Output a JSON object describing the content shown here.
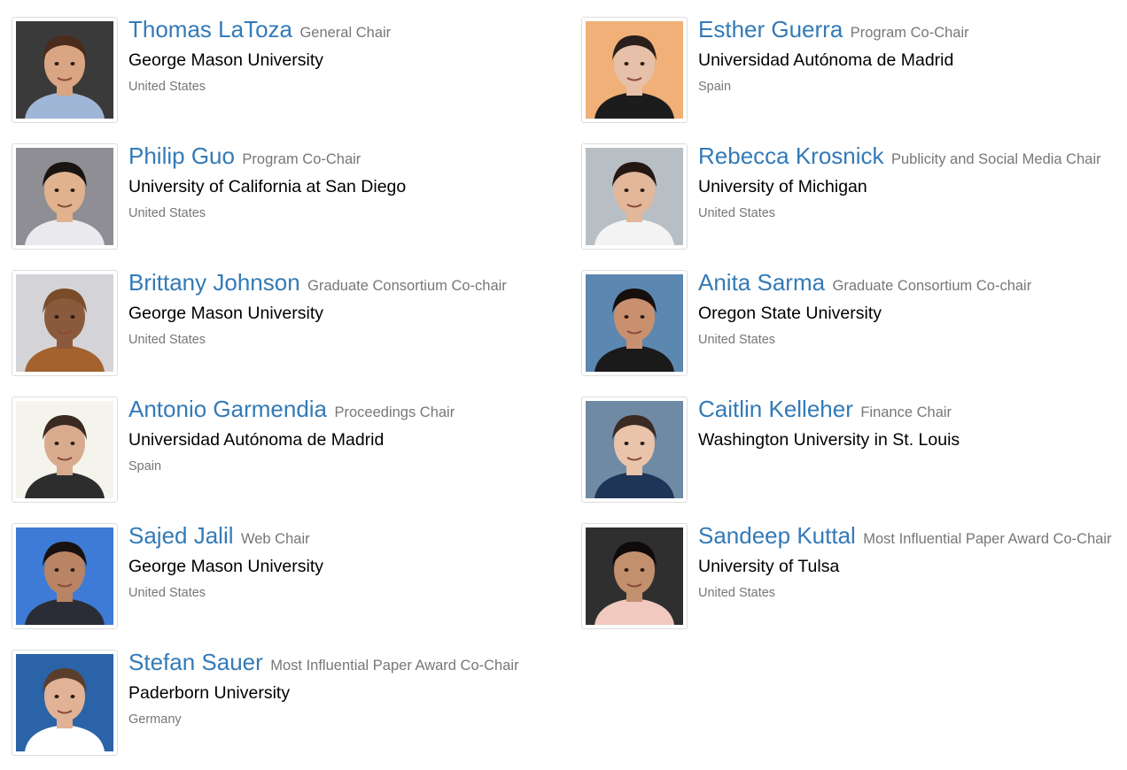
{
  "people": [
    {
      "name": "Thomas LaToza",
      "role": "General Chair",
      "affiliation": "George Mason University",
      "country": "United States",
      "colors": {
        "bg": "#3b3a3a",
        "skin": "#d9a583",
        "hair": "#4a2c1c",
        "shirt": "#9fb6d6"
      }
    },
    {
      "name": "Esther Guerra",
      "role": "Program Co-Chair",
      "affiliation": "Universidad Autónoma de Madrid",
      "country": "Spain",
      "colors": {
        "bg": "#f0b078",
        "skin": "#e6c0a8",
        "hair": "#2b1f1b",
        "shirt": "#1c1c1c"
      }
    },
    {
      "name": "Philip Guo",
      "role": "Program Co-Chair",
      "affiliation": "University of California at San Diego",
      "country": "United States",
      "colors": {
        "bg": "#8f8e95",
        "skin": "#e0b38e",
        "hair": "#1a1411",
        "shirt": "#e9e9ee"
      }
    },
    {
      "name": "Rebecca Krosnick",
      "role": "Publicity and Social Media Chair",
      "affiliation": "University of Michigan",
      "country": "United States",
      "colors": {
        "bg": "#b7bfc4",
        "skin": "#e2b79a",
        "hair": "#241812",
        "shirt": "#f3f3f3"
      }
    },
    {
      "name": "Brittany Johnson",
      "role": "Graduate Consortium Co-chair",
      "affiliation": "George Mason University",
      "country": "United States",
      "colors": {
        "bg": "#d4d4d8",
        "skin": "#8b5a3c",
        "hair": "#7a4d2a",
        "shirt": "#a3622e"
      }
    },
    {
      "name": "Anita Sarma",
      "role": "Graduate Consortium Co-chair",
      "affiliation": "Oregon State University",
      "country": "United States",
      "colors": {
        "bg": "#5b87b0",
        "skin": "#c99070",
        "hair": "#150f0d",
        "shirt": "#1a1a1a"
      }
    },
    {
      "name": "Antonio Garmendia",
      "role": "Proceedings Chair",
      "affiliation": "Universidad Autónoma de Madrid",
      "country": "Spain",
      "colors": {
        "bg": "#f5f4ec",
        "skin": "#d9ab8e",
        "hair": "#3a2a22",
        "shirt": "#2d2d2d"
      }
    },
    {
      "name": "Caitlin Kelleher",
      "role": "Finance Chair",
      "affiliation": "Washington University in St. Louis",
      "country": "",
      "colors": {
        "bg": "#6f8aa5",
        "skin": "#e9c3aa",
        "hair": "#3a2a22",
        "shirt": "#1f3557"
      }
    },
    {
      "name": "Sajed Jalil",
      "role": "Web Chair",
      "affiliation": "George Mason University",
      "country": "United States",
      "colors": {
        "bg": "#3d7bd6",
        "skin": "#b98463",
        "hair": "#171210",
        "shirt": "#2a2d35"
      }
    },
    {
      "name": "Sandeep Kuttal",
      "role": "Most Influential Paper Award Co-Chair",
      "affiliation": "University of Tulsa",
      "country": "United States",
      "colors": {
        "bg": "#2f2f2f",
        "skin": "#c3906e",
        "hair": "#0f0b0a",
        "shirt": "#f1c9bf"
      }
    },
    {
      "name": "Stefan Sauer",
      "role": "Most Influential Paper Award Co-Chair",
      "affiliation": "Paderborn University",
      "country": "Germany",
      "colors": {
        "bg": "#2b63a8",
        "skin": "#e1b295",
        "hair": "#5a3e2b",
        "shirt": "#ffffff"
      }
    }
  ]
}
